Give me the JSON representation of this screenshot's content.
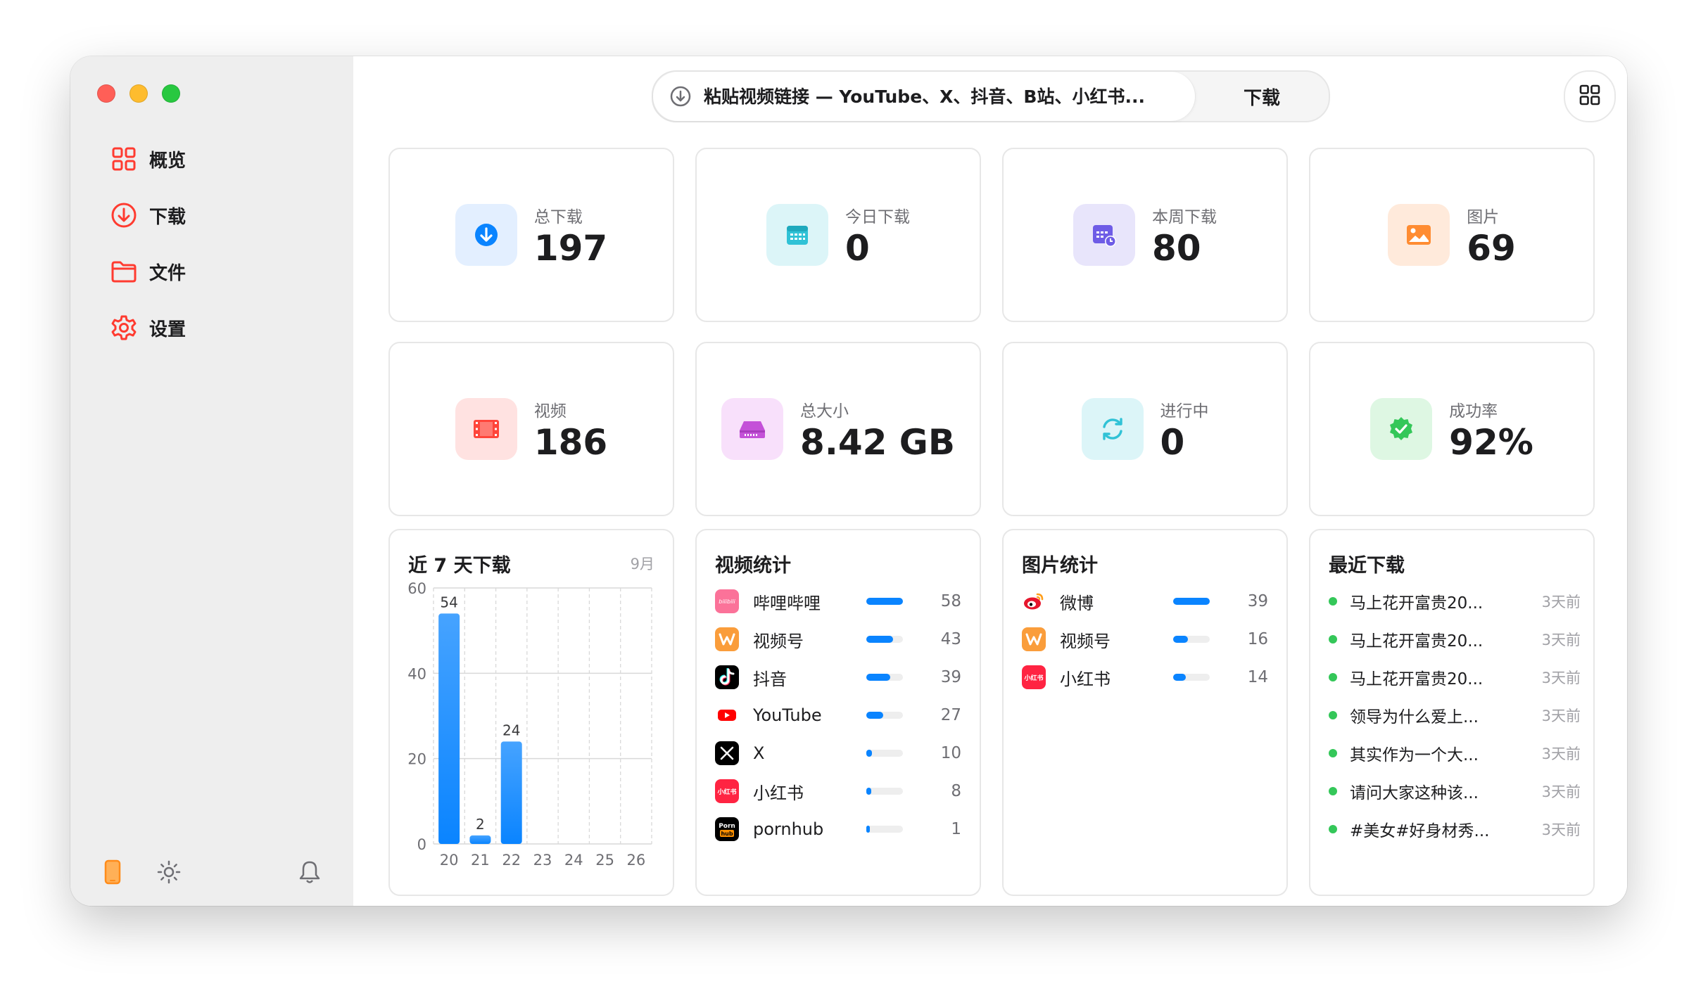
{
  "sidebar": {
    "items": [
      {
        "label": "概览",
        "icon": "grid-icon"
      },
      {
        "label": "下载",
        "icon": "download-circle-icon"
      },
      {
        "label": "文件",
        "icon": "folder-icon"
      },
      {
        "label": "设置",
        "icon": "gear-icon"
      }
    ],
    "bottom_icons": [
      "phone-icon",
      "sun-icon",
      "bell-icon"
    ],
    "accent_color": "#ff3b30"
  },
  "toolbar": {
    "url_placeholder": "粘贴视频链接 — YouTube、X、抖音、B站、小红书...",
    "download_label": "下载"
  },
  "stats": [
    {
      "label": "总下载",
      "value": "197",
      "icon": "download-icon",
      "color": "#0a84ff"
    },
    {
      "label": "今日下载",
      "value": "0",
      "icon": "calendar-icon",
      "color": "#30c2d6"
    },
    {
      "label": "本周下载",
      "value": "80",
      "icon": "calendar-clock-icon",
      "color": "#6e5ce6"
    },
    {
      "label": "图片",
      "value": "69",
      "icon": "photo-icon",
      "color": "#ff8c32"
    },
    {
      "label": "视频",
      "value": "186",
      "icon": "film-icon",
      "color": "#ff453a"
    },
    {
      "label": "总大小",
      "value": "8.42 GB",
      "icon": "drive-icon",
      "color": "#c451d8"
    },
    {
      "label": "进行中",
      "value": "0",
      "icon": "sync-icon",
      "color": "#30c2d6"
    },
    {
      "label": "成功率",
      "value": "92%",
      "icon": "check-badge-icon",
      "color": "#34c759"
    }
  ],
  "weekly": {
    "title": "近 7 天下载",
    "month": "9月"
  },
  "chart_data": {
    "type": "bar",
    "title": "近 7 天下载",
    "categories": [
      "20",
      "21",
      "22",
      "23",
      "24",
      "25",
      "26"
    ],
    "values": [
      54,
      2,
      24,
      0,
      0,
      0,
      0
    ],
    "data_labels": [
      "54",
      "2",
      "24"
    ],
    "ylim": [
      0,
      60
    ],
    "yticks": [
      "0",
      "20",
      "40",
      "60"
    ],
    "grid": true,
    "bar_color": "#0a84ff"
  },
  "video_stats": {
    "title": "视频统计",
    "items": [
      {
        "name": "哔哩哔哩",
        "count": "58",
        "share": 1.0,
        "icon": "bilibili-icon",
        "color": "#fb7299"
      },
      {
        "name": "视频号",
        "count": "43",
        "share": 0.74,
        "icon": "channels-icon",
        "color": "#fa9d3b"
      },
      {
        "name": "抖音",
        "count": "39",
        "share": 0.67,
        "icon": "douyin-icon",
        "color": "#000000"
      },
      {
        "name": "YouTube",
        "count": "27",
        "share": 0.47,
        "icon": "youtube-icon",
        "color": "#ff0000"
      },
      {
        "name": "X",
        "count": "10",
        "share": 0.17,
        "icon": "x-icon",
        "color": "#000000"
      },
      {
        "name": "小红书",
        "count": "8",
        "share": 0.14,
        "icon": "xiaohongshu-icon",
        "color": "#ff2442"
      },
      {
        "name": "pornhub",
        "count": "1",
        "share": 0.1,
        "icon": "pornhub-icon",
        "color": "#000000"
      }
    ]
  },
  "image_stats": {
    "title": "图片统计",
    "items": [
      {
        "name": "微博",
        "count": "39",
        "share": 1.0,
        "icon": "weibo-icon",
        "color": "#e6162d"
      },
      {
        "name": "视频号",
        "count": "16",
        "share": 0.41,
        "icon": "channels-icon",
        "color": "#fa9d3b"
      },
      {
        "name": "小红书",
        "count": "14",
        "share": 0.36,
        "icon": "xiaohongshu-icon",
        "color": "#ff2442"
      }
    ]
  },
  "recent": {
    "title": "最近下载",
    "items": [
      {
        "title": "马上花开富贵20...",
        "time": "3天前"
      },
      {
        "title": "马上花开富贵20...",
        "time": "3天前"
      },
      {
        "title": "马上花开富贵20...",
        "time": "3天前"
      },
      {
        "title": "领导为什么爱上...",
        "time": "3天前"
      },
      {
        "title": "其实作为一个大...",
        "time": "3天前"
      },
      {
        "title": "请问大家这种该...",
        "time": "3天前"
      },
      {
        "title": "#美女#好身材秀...",
        "time": "3天前"
      }
    ]
  },
  "icons": {
    "xiaohongshu_badge": "小红书",
    "pornhub_badge": "Porn hub",
    "bilibili_badge": "bilibili"
  }
}
